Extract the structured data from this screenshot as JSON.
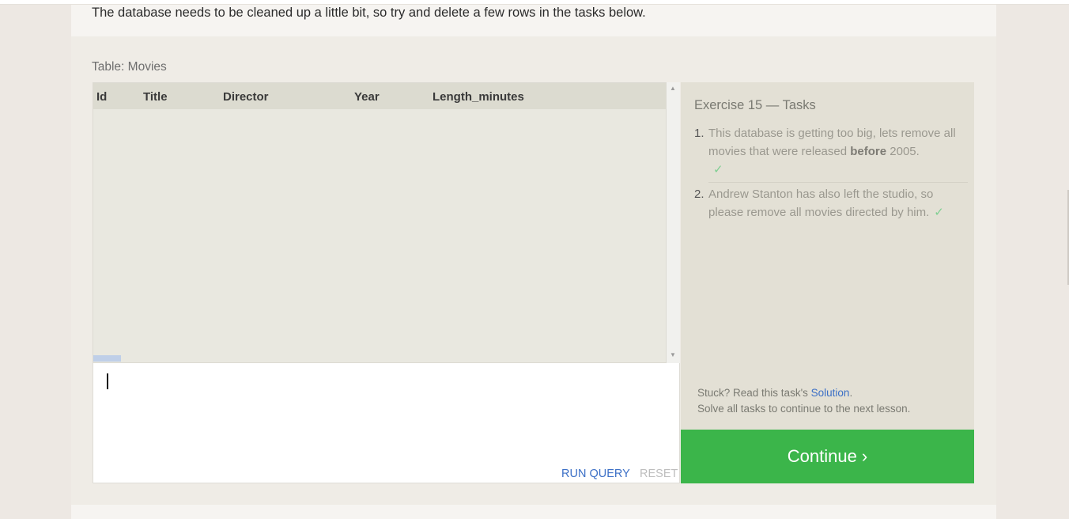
{
  "intro_text": "The database needs to be cleaned up a little bit, so try and delete a few rows in the tasks below.",
  "table_label": "Table: Movies",
  "columns": [
    "Id",
    "Title",
    "Director",
    "Year",
    "Length_minutes"
  ],
  "editor": {
    "value": ""
  },
  "buttons": {
    "run": "RUN QUERY",
    "reset": "RESET"
  },
  "exercise": {
    "title": "Exercise 15 — Tasks",
    "tasks": [
      {
        "num": "1.",
        "pre": "This database is getting too big, lets remove all movies that were released ",
        "bold": "before",
        "post": " 2005.",
        "check": "✓"
      },
      {
        "num": "2.",
        "pre": "Andrew Stanton has also left the studio, so please remove all movies directed by him.",
        "bold": "",
        "post": "",
        "check": "✓"
      }
    ]
  },
  "help": {
    "stuck_prefix": "Stuck? Read this task's ",
    "solution_link": "Solution",
    "stuck_suffix": ".",
    "solve_text": "Solve all tasks to continue to the next lesson."
  },
  "continue_label": "Continue ›",
  "colors": {
    "accent": "#3bb54a",
    "link": "#3b6fc6",
    "check": "#7fcf92"
  }
}
